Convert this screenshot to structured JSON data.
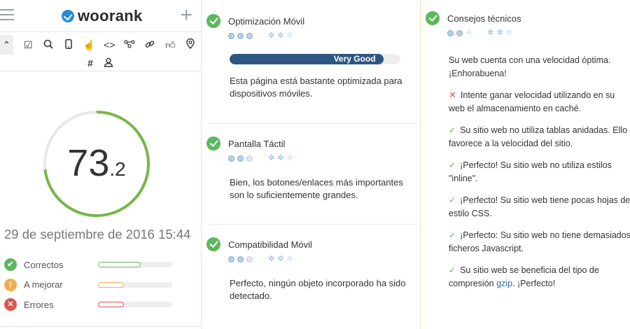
{
  "brand": {
    "logo_text": "woorank"
  },
  "header": {
    "menu_icon": "hamburger-icon",
    "add_icon": "plus-icon"
  },
  "toolbar": {
    "row1": [
      "chevron-up-icon",
      "checkbox-icon",
      "search-icon",
      "mobile-icon",
      "hand-pointer-icon",
      "code-icon",
      "network-icon",
      "link-icon",
      "thumbs-up-icon",
      "location-pin-icon"
    ],
    "row2": [
      "hashtag-icon",
      "user-icon"
    ]
  },
  "score": {
    "integer": "73",
    "decimal": ".2",
    "value": 73.2,
    "max": 100,
    "color": "#7ab648"
  },
  "date": "29 de septiembre de 2016 15:44",
  "stats": [
    {
      "label": "Correctos",
      "badge": "✔",
      "color": "#5cb85c",
      "fill": 0.58,
      "bar_color": "#5cb85c"
    },
    {
      "label": "A mejorar",
      "badge": "!",
      "color": "#f0ad4e",
      "fill": 0.35,
      "bar_color": "#f0ad4e"
    },
    {
      "label": "Errores",
      "badge": "✕",
      "color": "#d9534f",
      "fill": 0.35,
      "bar_color": "#d9534f"
    }
  ],
  "sections": [
    {
      "title": "Optimización Móvil",
      "progress": {
        "label": "Very Good",
        "value": 0.9,
        "color": "#2d5782"
      },
      "text": "Esta página está bastante optimizada para dispositivos móviles."
    },
    {
      "title": "Pantalla Táctil",
      "text": "Bien, los botones/enlaces más importantes son lo suficientemente grandes."
    },
    {
      "title": "Compatibilidad Móvil",
      "text": "Perfecto, ningún objeto incorporado ha sido detectado."
    }
  ],
  "tech": {
    "title": "Consejos técnicos",
    "intro": "Su web cuenta con una velocidad óptima. ¡Enhorabuena!",
    "tips": [
      {
        "status": "error",
        "text": "Intente ganar velocidad utilizando en su web el almacenamiento en caché."
      },
      {
        "status": "ok",
        "text": "Su sitio web no utiliza tablas anidadas. Ello favorece a la velocidad del sitio."
      },
      {
        "status": "ok",
        "text": "¡Perfecto! Su sitio web no utiliza estilos \"inline\"."
      },
      {
        "status": "ok",
        "text": "¡Perfecto! Su sitio web tiene pocas hojas de estilo CSS."
      },
      {
        "status": "ok",
        "text": "¡Perfecto: Su sitio web no tiene demasiados ficheros Javascript."
      }
    ],
    "last_tip": {
      "before": "Su sitio web se beneficia del tipo de compresión ",
      "link": "gzip",
      "after": ". ¡Perfecto!"
    }
  },
  "colors": {
    "accent": "#2c8ad8",
    "success": "#5cb85c",
    "warning": "#f0ad4e",
    "danger": "#d9534f",
    "divider": "#efe9a8"
  }
}
